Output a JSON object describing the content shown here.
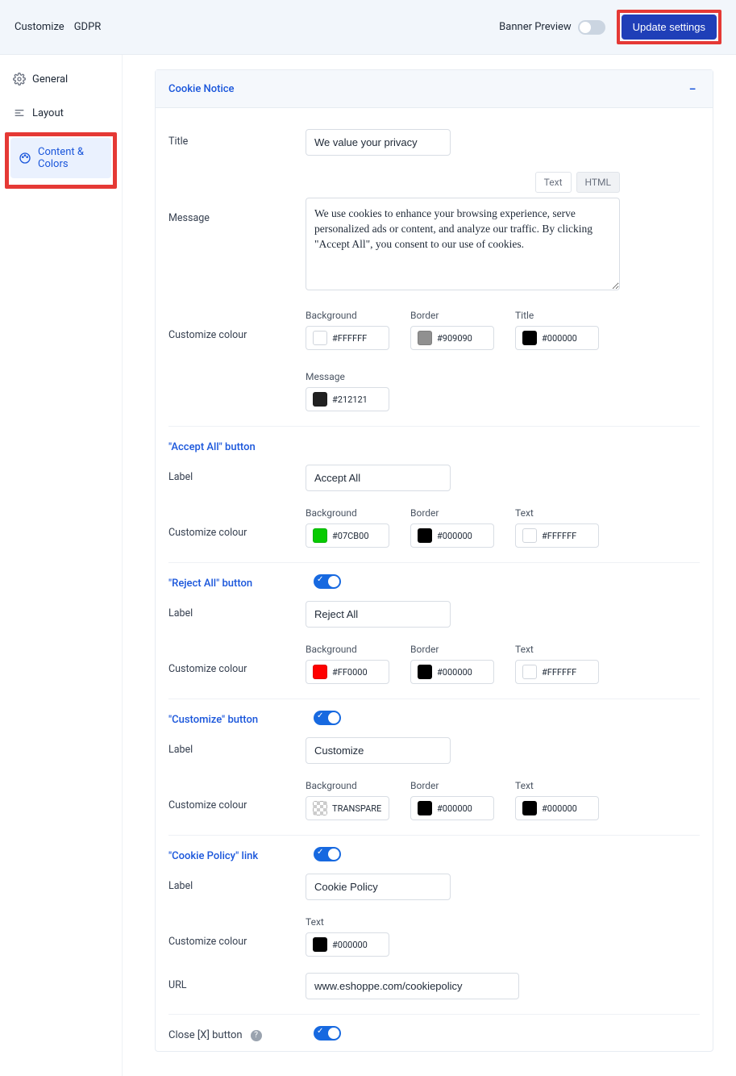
{
  "header": {
    "breadcrumbs": [
      "Customize",
      "GDPR"
    ],
    "banner_preview_label": "Banner Preview",
    "banner_preview_on": false,
    "update_button": "Update settings"
  },
  "sidebar": {
    "items": [
      {
        "id": "general",
        "label": "General",
        "icon": "gear-icon",
        "active": false
      },
      {
        "id": "layout",
        "label": "Layout",
        "icon": "bars-icon",
        "active": false
      },
      {
        "id": "content-colors",
        "label": "Content & Colors",
        "icon": "palette-icon",
        "active": true
      }
    ]
  },
  "panel": {
    "title": "Cookie Notice",
    "fields": {
      "title_label": "Title",
      "title_value": "We value your privacy",
      "message_label": "Message",
      "message_tabs": {
        "text": "Text",
        "html": "HTML"
      },
      "message_value": "We use cookies to enhance your browsing experience, serve personalized ads or content, and analyze our traffic. By clicking \"Accept All\", you consent to our use of cookies.",
      "customize_colour_label": "Customize colour",
      "notice_colors": {
        "background": {
          "label": "Background",
          "value": "#FFFFFF",
          "swatch": "#FFFFFF"
        },
        "border": {
          "label": "Border",
          "value": "#909090",
          "swatch": "#909090"
        },
        "title": {
          "label": "Title",
          "value": "#000000",
          "swatch": "#000000"
        },
        "message": {
          "label": "Message",
          "value": "#212121",
          "swatch": "#212121"
        }
      }
    },
    "accept_btn": {
      "heading": "\"Accept All\" button",
      "label_label": "Label",
      "label_value": "Accept All",
      "colors": {
        "background": {
          "label": "Background",
          "value": "#07CB00",
          "swatch": "#07CB00"
        },
        "border": {
          "label": "Border",
          "value": "#000000",
          "swatch": "#000000"
        },
        "text": {
          "label": "Text",
          "value": "#FFFFFF",
          "swatch": "#FFFFFF"
        }
      }
    },
    "reject_btn": {
      "heading": "\"Reject All\" button",
      "enabled": true,
      "label_label": "Label",
      "label_value": "Reject All",
      "colors": {
        "background": {
          "label": "Background",
          "value": "#FF0000",
          "swatch": "#FF0000"
        },
        "border": {
          "label": "Border",
          "value": "#000000",
          "swatch": "#000000"
        },
        "text": {
          "label": "Text",
          "value": "#FFFFFF",
          "swatch": "#FFFFFF"
        }
      }
    },
    "customize_btn": {
      "heading": "\"Customize\" button",
      "enabled": true,
      "label_label": "Label",
      "label_value": "Customize",
      "colors": {
        "background": {
          "label": "Background",
          "value": "TRANSPARE",
          "swatch": "transparent"
        },
        "border": {
          "label": "Border",
          "value": "#000000",
          "swatch": "#000000"
        },
        "text": {
          "label": "Text",
          "value": "#000000",
          "swatch": "#000000"
        }
      }
    },
    "cookie_policy": {
      "heading": "\"Cookie Policy\" link",
      "enabled": true,
      "label_label": "Label",
      "label_value": "Cookie Policy",
      "text_color": {
        "label": "Text",
        "value": "#000000",
        "swatch": "#000000"
      },
      "url_label": "URL",
      "url_value": "www.eshoppe.com/cookiepolicy"
    },
    "close_btn": {
      "heading": "Close [X] button",
      "enabled": true
    },
    "common": {
      "customize_colour": "Customize colour"
    }
  }
}
